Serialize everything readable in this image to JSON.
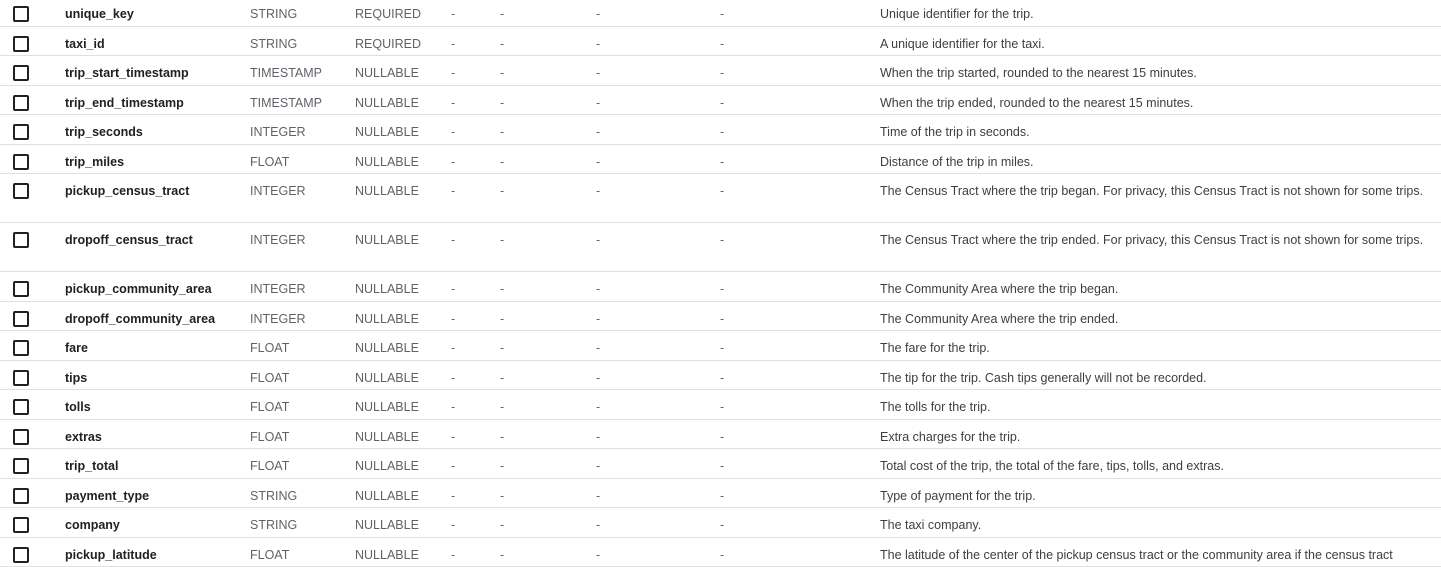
{
  "schema": {
    "rows": [
      {
        "name": "unique_key",
        "type": "STRING",
        "mode": "REQUIRED",
        "c1": "-",
        "c2": "-",
        "c3": "-",
        "c4": "-",
        "description": "Unique identifier for the trip."
      },
      {
        "name": "taxi_id",
        "type": "STRING",
        "mode": "REQUIRED",
        "c1": "-",
        "c2": "-",
        "c3": "-",
        "c4": "-",
        "description": "A unique identifier for the taxi."
      },
      {
        "name": "trip_start_timestamp",
        "type": "TIMESTAMP",
        "mode": "NULLABLE",
        "c1": "-",
        "c2": "-",
        "c3": "-",
        "c4": "-",
        "description": "When the trip started, rounded to the nearest 15 minutes."
      },
      {
        "name": "trip_end_timestamp",
        "type": "TIMESTAMP",
        "mode": "NULLABLE",
        "c1": "-",
        "c2": "-",
        "c3": "-",
        "c4": "-",
        "description": "When the trip ended, rounded to the nearest 15 minutes."
      },
      {
        "name": "trip_seconds",
        "type": "INTEGER",
        "mode": "NULLABLE",
        "c1": "-",
        "c2": "-",
        "c3": "-",
        "c4": "-",
        "description": "Time of the trip in seconds."
      },
      {
        "name": "trip_miles",
        "type": "FLOAT",
        "mode": "NULLABLE",
        "c1": "-",
        "c2": "-",
        "c3": "-",
        "c4": "-",
        "description": "Distance of the trip in miles."
      },
      {
        "name": "pickup_census_tract",
        "type": "INTEGER",
        "mode": "NULLABLE",
        "c1": "-",
        "c2": "-",
        "c3": "-",
        "c4": "-",
        "description": "The Census Tract where the trip began. For privacy, this Census Tract is not shown for some trips."
      },
      {
        "name": "dropoff_census_tract",
        "type": "INTEGER",
        "mode": "NULLABLE",
        "c1": "-",
        "c2": "-",
        "c3": "-",
        "c4": "-",
        "description": "The Census Tract where the trip ended. For privacy, this Census Tract is not shown for some trips."
      },
      {
        "name": "pickup_community_area",
        "type": "INTEGER",
        "mode": "NULLABLE",
        "c1": "-",
        "c2": "-",
        "c3": "-",
        "c4": "-",
        "description": "The Community Area where the trip began."
      },
      {
        "name": "dropoff_community_area",
        "type": "INTEGER",
        "mode": "NULLABLE",
        "c1": "-",
        "c2": "-",
        "c3": "-",
        "c4": "-",
        "description": "The Community Area where the trip ended."
      },
      {
        "name": "fare",
        "type": "FLOAT",
        "mode": "NULLABLE",
        "c1": "-",
        "c2": "-",
        "c3": "-",
        "c4": "-",
        "description": "The fare for the trip."
      },
      {
        "name": "tips",
        "type": "FLOAT",
        "mode": "NULLABLE",
        "c1": "-",
        "c2": "-",
        "c3": "-",
        "c4": "-",
        "description": "The tip for the trip. Cash tips generally will not be recorded."
      },
      {
        "name": "tolls",
        "type": "FLOAT",
        "mode": "NULLABLE",
        "c1": "-",
        "c2": "-",
        "c3": "-",
        "c4": "-",
        "description": "The tolls for the trip."
      },
      {
        "name": "extras",
        "type": "FLOAT",
        "mode": "NULLABLE",
        "c1": "-",
        "c2": "-",
        "c3": "-",
        "c4": "-",
        "description": "Extra charges for the trip."
      },
      {
        "name": "trip_total",
        "type": "FLOAT",
        "mode": "NULLABLE",
        "c1": "-",
        "c2": "-",
        "c3": "-",
        "c4": "-",
        "description": "Total cost of the trip, the total of the fare, tips, tolls, and extras."
      },
      {
        "name": "payment_type",
        "type": "STRING",
        "mode": "NULLABLE",
        "c1": "-",
        "c2": "-",
        "c3": "-",
        "c4": "-",
        "description": "Type of payment for the trip."
      },
      {
        "name": "company",
        "type": "STRING",
        "mode": "NULLABLE",
        "c1": "-",
        "c2": "-",
        "c3": "-",
        "c4": "-",
        "description": "The taxi company."
      },
      {
        "name": "pickup_latitude",
        "type": "FLOAT",
        "mode": "NULLABLE",
        "c1": "-",
        "c2": "-",
        "c3": "-",
        "c4": "-",
        "description": "The latitude of the center of the pickup census tract or the community area if the census tract"
      }
    ]
  }
}
